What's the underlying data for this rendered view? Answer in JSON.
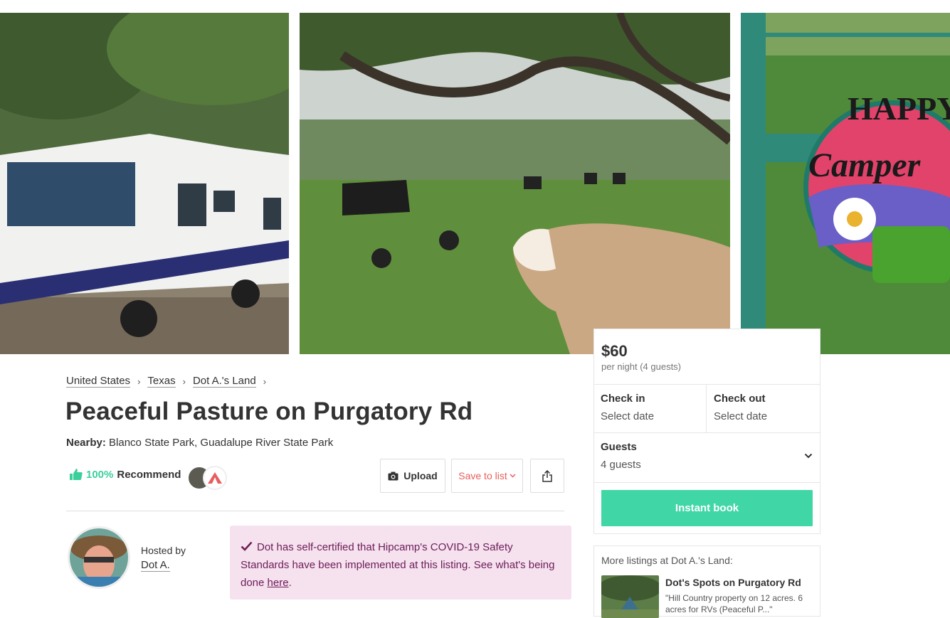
{
  "gallery": {
    "photos": [
      {
        "icon": "rv-motorhome-photo"
      },
      {
        "icon": "pasture-goat-cattle-photo"
      },
      {
        "icon": "happy-camper-sign-photo"
      }
    ],
    "sign_text": [
      "HAPPY",
      "Camper"
    ]
  },
  "breadcrumb": {
    "items": [
      "United States",
      "Texas",
      "Dot A.'s Land"
    ],
    "separator": "›"
  },
  "listing": {
    "title": "Peaceful Pasture on Purgatory Rd",
    "nearby_label": "Nearby:",
    "nearby_value": "Blanco State Park, Guadalupe River State Park"
  },
  "recommend": {
    "percent": "100%",
    "label": "Recommend"
  },
  "actions": {
    "upload_label": "Upload",
    "save_label": "Save to list",
    "save_caret": "⌄"
  },
  "host": {
    "hosted_by_label": "Hosted by",
    "name": "Dot A."
  },
  "covid_notice": {
    "text_before_link": "Dot has self-certified that Hipcamp's COVID-19 Safety Standards have been implemented at this listing. See what's being done ",
    "link_text": "here",
    "text_after_link": "."
  },
  "booking": {
    "price": "$60",
    "price_note": "per night (4 guests)",
    "check_in_label": "Check in",
    "check_in_value": "Select date",
    "check_out_label": "Check out",
    "check_out_value": "Select date",
    "guests_label": "Guests",
    "guests_value": "4 guests",
    "instant_book_label": "Instant book"
  },
  "more_listings": {
    "heading": "More listings at Dot A.'s Land:",
    "items": [
      {
        "title": "Dot's Spots on Purgatory Rd",
        "description": "\"Hill Country property on 12 acres. 6 acres for RVs (Peaceful P...\""
      }
    ]
  },
  "colors": {
    "accent": "#40d6a6",
    "recommend_green": "#3bcf9b",
    "save_red": "#e85e5e",
    "covid_bg": "#f6e1ef",
    "covid_text": "#6b1d57"
  }
}
